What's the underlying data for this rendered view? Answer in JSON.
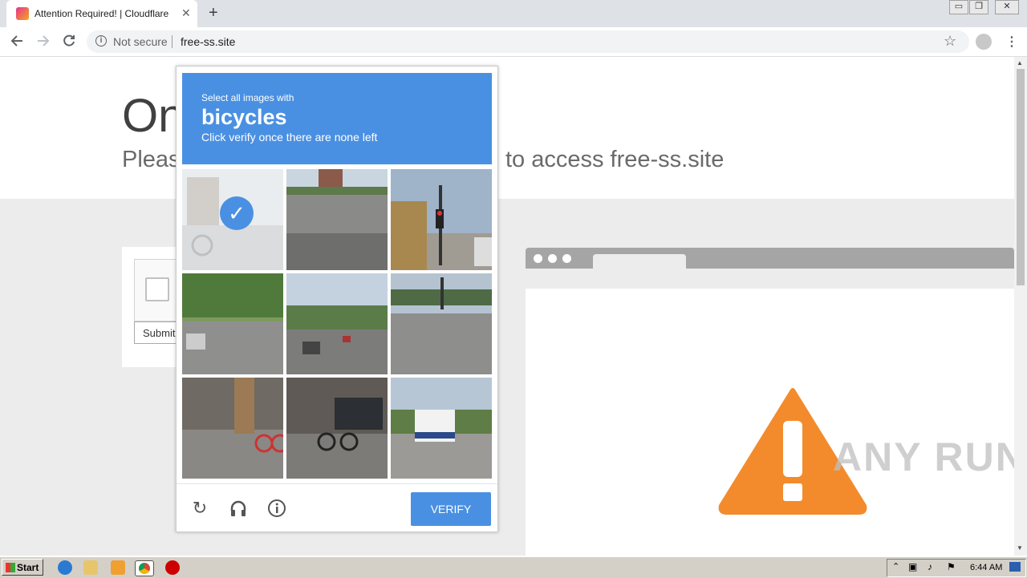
{
  "browser": {
    "tab_title": "Attention Required! | Cloudflare",
    "tab_close": "✕",
    "new_tab": "+",
    "not_secure": "Not secure",
    "url": "free-ss.site",
    "window_controls": [
      "▭",
      "❐",
      "✕"
    ]
  },
  "page": {
    "headline": "On",
    "subline_left": "Pleas",
    "subline_right": "to access free-ss.site",
    "submit_label": "Submit"
  },
  "challenge": {
    "instruction": "Select all images with",
    "keyword": "bicycles",
    "note": "Click verify once there are none left",
    "verify_label": "VERIFY",
    "tiles": [
      {
        "selected": true,
        "desc": "street-bicycle"
      },
      {
        "selected": false,
        "desc": "road"
      },
      {
        "selected": false,
        "desc": "traffic-light"
      },
      {
        "selected": false,
        "desc": "tree-street"
      },
      {
        "selected": false,
        "desc": "street-cars"
      },
      {
        "selected": false,
        "desc": "overpass"
      },
      {
        "selected": false,
        "desc": "crosswalk-bicycle"
      },
      {
        "selected": false,
        "desc": "bicycle-rider"
      },
      {
        "selected": false,
        "desc": "delivery-truck"
      }
    ],
    "icons": [
      "reload-icon",
      "audio-icon",
      "info-icon"
    ]
  },
  "watermark": "ANY RUN",
  "taskbar": {
    "start_label": "Start",
    "clock": "6:44 AM"
  }
}
